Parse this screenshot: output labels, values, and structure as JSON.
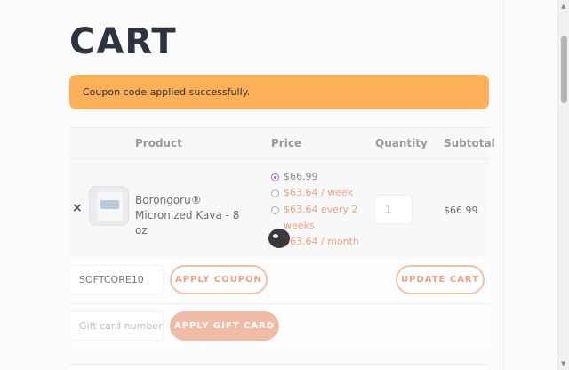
{
  "page": {
    "title": "CART"
  },
  "notice": {
    "message": "Coupon code applied successfully."
  },
  "table": {
    "headers": {
      "product": "Product",
      "price": "Price",
      "quantity": "Quantity",
      "subtotal": "Subtotal"
    },
    "row": {
      "remove": "×",
      "product_name": "Borongoru® Micronized Kava - 8 oz",
      "price_options": [
        {
          "label": "$66.99",
          "selected": true
        },
        {
          "label": "$63.64 / week",
          "selected": false
        },
        {
          "label": "$63.64 every 2 weeks",
          "selected": false
        },
        {
          "label": "$63.64 / month",
          "selected": false
        }
      ],
      "quantity": "1",
      "subtotal": "$66.99"
    }
  },
  "coupon": {
    "value": "SOFTCORE10",
    "apply_label": "APPLY COUPON"
  },
  "update_cart_label": "UPDATE CART",
  "gift_card": {
    "placeholder": "Gift card number",
    "apply_label": "APPLY GIFT CARD"
  },
  "colors": {
    "notice_bg": "#fdaf5a",
    "accent": "#eaa282",
    "radio_selected": "#a76bd0",
    "title": "#2e3340"
  },
  "icons": {
    "remove": "close-icon",
    "cursor": "mouse-cursor-icon"
  }
}
